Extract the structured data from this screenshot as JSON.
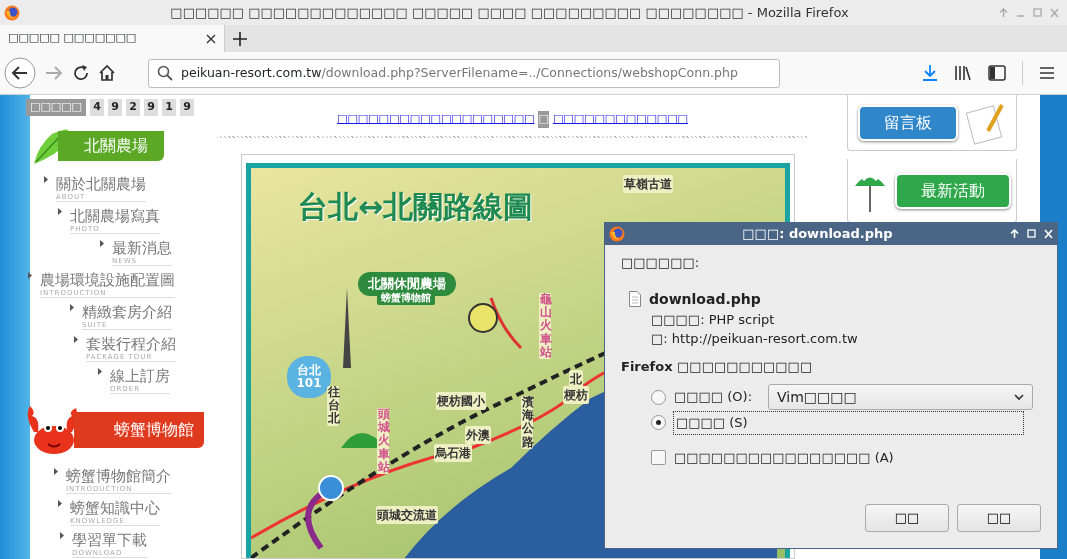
{
  "window": {
    "title": "□□□□□□ □□□□□□□□□□□□□ □□□□□ □□□□ □□□□□□□□□ □□□□□□□□ - Mozilla Firefox"
  },
  "tabs": [
    {
      "label": "□□□□□ □□□□□□□",
      "selected": true
    }
  ],
  "toolbar": {
    "url_host": "peikuan-resort.com.tw",
    "url_path": "/download.php?ServerFilename=../Connections/webshopConn.php",
    "forward_disabled": true
  },
  "page": {
    "counter": {
      "label": "□□□□□",
      "digits": [
        "4",
        "9",
        "2",
        "9",
        "1",
        "9"
      ]
    },
    "sidebar": [
      {
        "kind": "header",
        "label": "北關農場",
        "color": "#5aa824"
      },
      {
        "kind": "item",
        "label": "關於北關農場",
        "sublabel": "ABOUT"
      },
      {
        "kind": "item",
        "label": "北關農場寫真",
        "sublabel": "PHOTO"
      },
      {
        "kind": "item",
        "label": "最新消息",
        "sublabel": "NEWS"
      },
      {
        "kind": "item",
        "label": "農場環境設施配置圖",
        "sublabel": "INTRODUCTION"
      },
      {
        "kind": "item",
        "label": "精緻套房介紹",
        "sublabel": "SUITE"
      },
      {
        "kind": "item",
        "label": "套裝行程介紹",
        "sublabel": "PACKAGE TOUR"
      },
      {
        "kind": "item",
        "label": "線上訂房",
        "sublabel": "ORDER"
      },
      {
        "kind": "header",
        "label": "螃蟹博物館",
        "color": "#e03a1e"
      },
      {
        "kind": "item",
        "label": "螃蟹博物館簡介",
        "sublabel": "INTRODUCTION"
      },
      {
        "kind": "item",
        "label": "螃蟹知識中心",
        "sublabel": "KNOWLEDGE"
      },
      {
        "kind": "item",
        "label": "學習單下載",
        "sublabel": "DOWNLOAD"
      }
    ],
    "top_links": [
      "□□□□□□□□□□□□□□□□□□□",
      "□□□□□□□□□□□□□"
    ],
    "top_links_separator": "□",
    "map": {
      "title": "台北↔北關路線圖",
      "labels": [
        "草嶺古道",
        "北關休閒農場",
        "螃蟹博物館",
        "龜山火車站",
        "台北101",
        "往台北",
        "頭城火車站",
        "梗枋國小",
        "外澳",
        "烏石港",
        "濱海公路",
        "頭城交流道",
        "北",
        "梗枋"
      ]
    },
    "right_buttons": [
      {
        "label": "留言板",
        "color": "#2f86c8"
      },
      {
        "label": "最新活動",
        "color": "#2ea84a"
      }
    ]
  },
  "dialog": {
    "title": "□□□: download.php",
    "intro": "□□□□□□:",
    "file_name": "download.php",
    "file_type": "□□□□: PHP script",
    "source": "□: http://peikuan-resort.com.tw",
    "question": "Firefox □□□□□□□□□□□",
    "options": [
      {
        "label": "□□□□ (O):",
        "selected": false,
        "app": "Vim□□□□"
      },
      {
        "label": "□□□□ (S)",
        "selected": true
      }
    ],
    "remember": {
      "label": "□□□□□□□□□□□□□□□□ (A)",
      "checked": false
    },
    "buttons": [
      "□□",
      "□□"
    ]
  }
}
